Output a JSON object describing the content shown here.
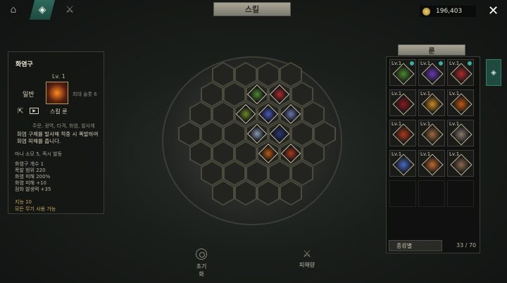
{
  "header": {
    "title": "스킬",
    "currency_value": "196,403"
  },
  "left_panel": {
    "skill_name": "화염구",
    "level": "Lv. 1",
    "grade": "일반",
    "slot_info": "최대 슬롯 6",
    "skill_label": "스킬 룬",
    "tags": "주문, 광역, 타격, 화염, 발사체",
    "description": "화염 구체를 발사해 적중 시 폭발하여 화염 피해를 줍니다.",
    "mana": "마나 소모 5, 즉시 발동",
    "stats": [
      "화염구 개수 1",
      "폭발 범위 220",
      "화염 피해 200%",
      "화염 피해 +10",
      "점화 발생력 +35"
    ],
    "requirements": [
      "지능 10",
      "모든 무기 사용 가능"
    ]
  },
  "board": {
    "reset_label": "초기화",
    "damage_label": "피해량"
  },
  "rune_panel": {
    "title": "룬",
    "sort_label": "종류별",
    "count": "33 / 70",
    "items": [
      {
        "level": "Lv.1",
        "color": "#4a8a2a"
      },
      {
        "level": "Lv.1",
        "color": "#6a3ab0"
      },
      {
        "level": "Lv.1",
        "color": "#b02a2a"
      },
      {
        "level": "Lv.1",
        "color": "#8a1a1a"
      },
      {
        "level": "Lv.1",
        "color": "#d08a20"
      },
      {
        "level": "Lv.1",
        "color": "#c05a10"
      },
      {
        "level": "Lv.1",
        "color": "#b03a1a"
      },
      {
        "level": "Lv.1",
        "color": "#a06a3a"
      },
      {
        "level": "Lv.1",
        "color": "#8a7a6a"
      },
      {
        "level": "Lv.1",
        "color": "#4a6ac0"
      },
      {
        "level": "Lv.1",
        "color": "#c06a2a"
      },
      {
        "level": "Lv.1",
        "color": "#8a6a4a"
      }
    ]
  }
}
